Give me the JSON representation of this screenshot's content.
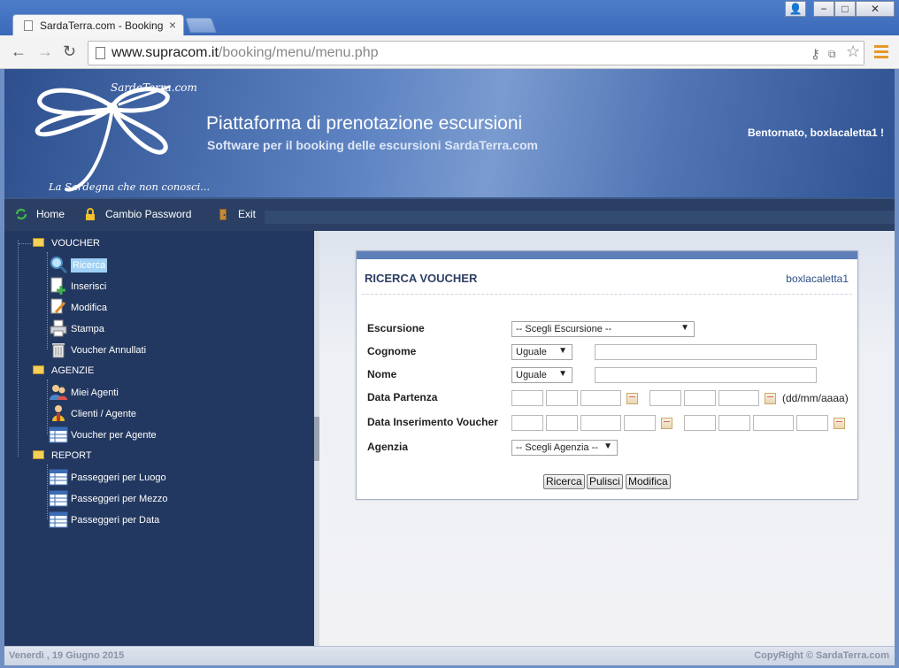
{
  "browser": {
    "tab_title": "SardaTerra.com - Booking Sc",
    "tab_close": "×",
    "url_host": "www.supracom.it",
    "url_path": "/booking/menu/menu.php",
    "win_user": "👤",
    "win_min": "−",
    "win_max": "□",
    "win_close": "✕",
    "back": "←",
    "forward": "→",
    "reload": "↻"
  },
  "header": {
    "brand": "SardaTerra.com",
    "tagline": "La Sardegna che non conosci...",
    "title": "Piattaforma di prenotazione escursioni",
    "subtitle": "Software per il booking delle escursioni SardaTerra.com",
    "welcome": "Bentornato, boxlacaletta1 !"
  },
  "nav": {
    "home": "Home",
    "password": "Cambio Password",
    "exit": "Exit"
  },
  "sidebar": {
    "groups": [
      {
        "label": "VOUCHER",
        "items": [
          "Ricerca",
          "Inserisci",
          "Modifica",
          "Stampa",
          "Voucher Annullati"
        ]
      },
      {
        "label": "AGENZIE",
        "items": [
          "Miei Agenti",
          "Clienti / Agente",
          "Voucher per Agente"
        ]
      },
      {
        "label": "REPORT",
        "items": [
          "Passeggeri per Luogo",
          "Passeggeri per Mezzo",
          "Passeggeri per Data"
        ]
      }
    ]
  },
  "form": {
    "title": "RICERCA VOUCHER",
    "user": "boxlacaletta1",
    "escursione_label": "Escursione",
    "escursione_value": "-- Scegli Escursione --",
    "cognome_label": "Cognome",
    "cognome_op": "Uguale",
    "nome_label": "Nome",
    "nome_op": "Uguale",
    "partenza_label": "Data Partenza",
    "date_hint": "(dd/mm/aaaa)",
    "inserimento_label": "Data Inserimento Voucher",
    "agenzia_label": "Agenzia",
    "agenzia_value": "-- Scegli Agenzia --",
    "btn_ricerca": "Ricerca",
    "btn_pulisci": "Pulisci",
    "btn_modifica": "Modifica"
  },
  "footer": {
    "date": "Venerdì , 19 Giugno 2015",
    "copyright": "CopyRight © SardaTerra.com"
  }
}
